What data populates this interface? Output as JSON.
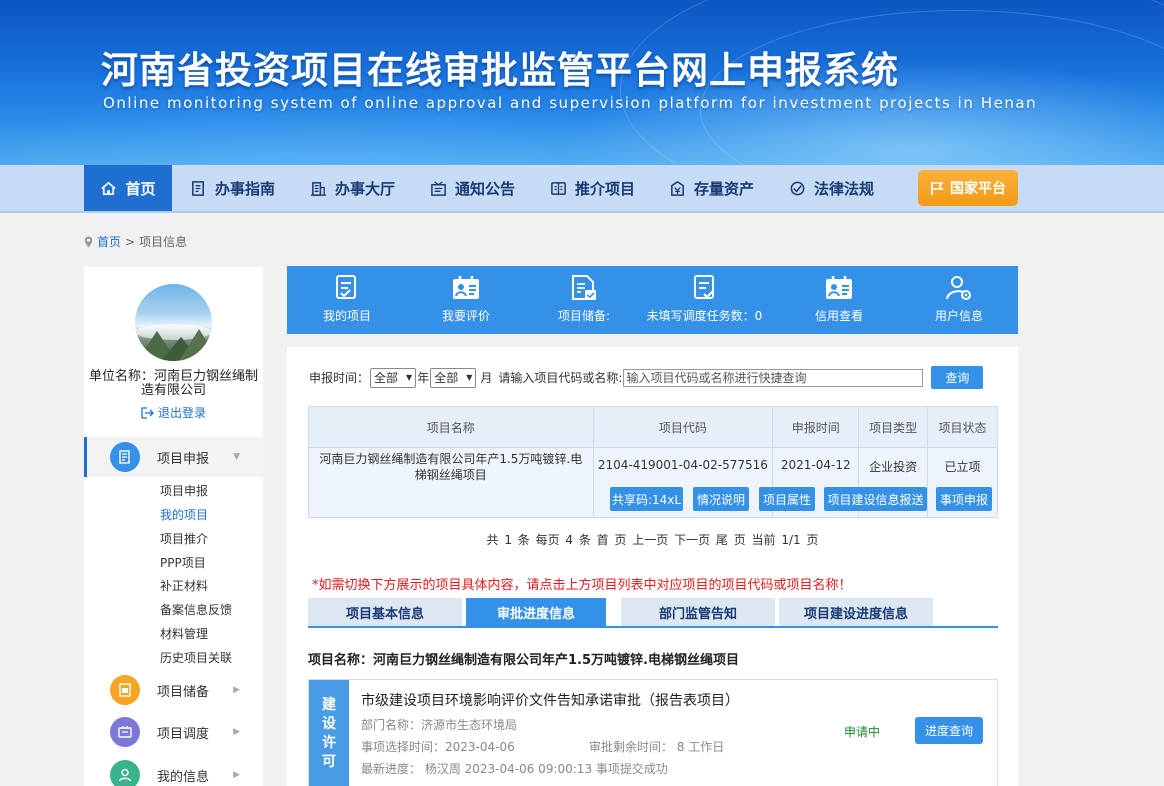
{
  "banner": {
    "title": "河南省投资项目在线审批监管平台网上申报系统",
    "subtitle": "Online monitoring system of online approval and supervision platform for investment projects in Henan"
  },
  "nav": {
    "items": [
      {
        "label": "首页",
        "icon": "home-icon",
        "active": true
      },
      {
        "label": "办事指南",
        "icon": "guide-doc-icon"
      },
      {
        "label": "办事大厅",
        "icon": "building-icon"
      },
      {
        "label": "通知公告",
        "icon": "notice-icon"
      },
      {
        "label": "推介项目",
        "icon": "promote-icon"
      },
      {
        "label": "存量资产",
        "icon": "asset-icon"
      },
      {
        "label": "法律法规",
        "icon": "law-icon"
      }
    ],
    "national": "国家平台"
  },
  "breadcrumb": {
    "home": "首页",
    "sep": ">",
    "current": "项目信息"
  },
  "sidebar": {
    "company": "单位名称：河南巨力钢丝绳制造有限公司",
    "logout": "退出登录",
    "main_item": "项目申报",
    "sub_items": [
      "项目申报",
      "我的项目",
      "项目推介",
      "PPP项目",
      "补正材料",
      "备案信息反馈",
      "材料管理",
      "历史项目关联"
    ],
    "active_sub": "我的项目",
    "groups": [
      {
        "label": "项目储备",
        "color": "#f6a623"
      },
      {
        "label": "项目调度",
        "color": "#7b78d8"
      },
      {
        "label": "我的信息",
        "color": "#3ab38d"
      }
    ],
    "colors": {
      "main": "#3591e8"
    }
  },
  "tools": [
    {
      "label": "我的项目",
      "icon": "list-check-icon"
    },
    {
      "label": "我要评价",
      "icon": "rating-icon"
    },
    {
      "label": "项目储备:",
      "icon": "reserve-doc-icon"
    },
    {
      "label": "未填写调度任务数：0",
      "icon": "task-check-icon"
    },
    {
      "label": "信用查看",
      "icon": "credit-icon"
    },
    {
      "label": "用户信息",
      "icon": "user-settings-icon"
    }
  ],
  "search": {
    "label_time": "申报时间：",
    "year_value": "全部",
    "year_unit": "年",
    "month_value": "全部",
    "month_unit": "月",
    "label_code": "请输入项目代码或名称:",
    "placeholder": "输入项目代码或名称进行快捷查询",
    "button": "查询"
  },
  "table": {
    "headers": [
      "项目名称",
      "项目代码",
      "申报时间",
      "项目类型",
      "项目状态"
    ],
    "rows": [
      {
        "name": "河南巨力钢丝绳制造有限公司年产1.5万吨镀锌.电梯钢丝绳项目",
        "code": "2104-419001-04-02-577516",
        "date": "2021-04-12",
        "type": "企业投资",
        "status": "已立项"
      }
    ],
    "actions": [
      "共享码:14xL",
      "情况说明",
      "项目属性",
      "项目建设信息报送",
      "事项申报"
    ]
  },
  "pagination": "共 1 条  每页 4 条  首 页 上一页  下一页   尾 页  当前 1/1 页",
  "tip": "*如需切换下方展示的项目具体内容，请点击上方项目列表中对应项目的项目代码或项目名称！",
  "tabs": [
    "项目基本信息",
    "审批进度信息",
    "部门监管告知",
    "项目建设进度信息"
  ],
  "active_tab": "审批进度信息",
  "project_name": "项目名称：河南巨力钢丝绳制造有限公司年产1.5万吨镀锌.电梯钢丝绳项目",
  "card": {
    "category": [
      "建",
      "设",
      "许",
      "可"
    ],
    "title": "市级建设项目环境影响评价文件告知承诺审批（报告表项目）",
    "dept": "部门名称：济源市生态环境局",
    "select_time": "事项选择时间：2023-04-06",
    "remain_time": "审批剩余时间：  8 工作日",
    "latest": "最新进度：  杨汉周 2023-04-06 09:00:13  事项提交成功",
    "status": "申请中",
    "button": "进度查询"
  }
}
